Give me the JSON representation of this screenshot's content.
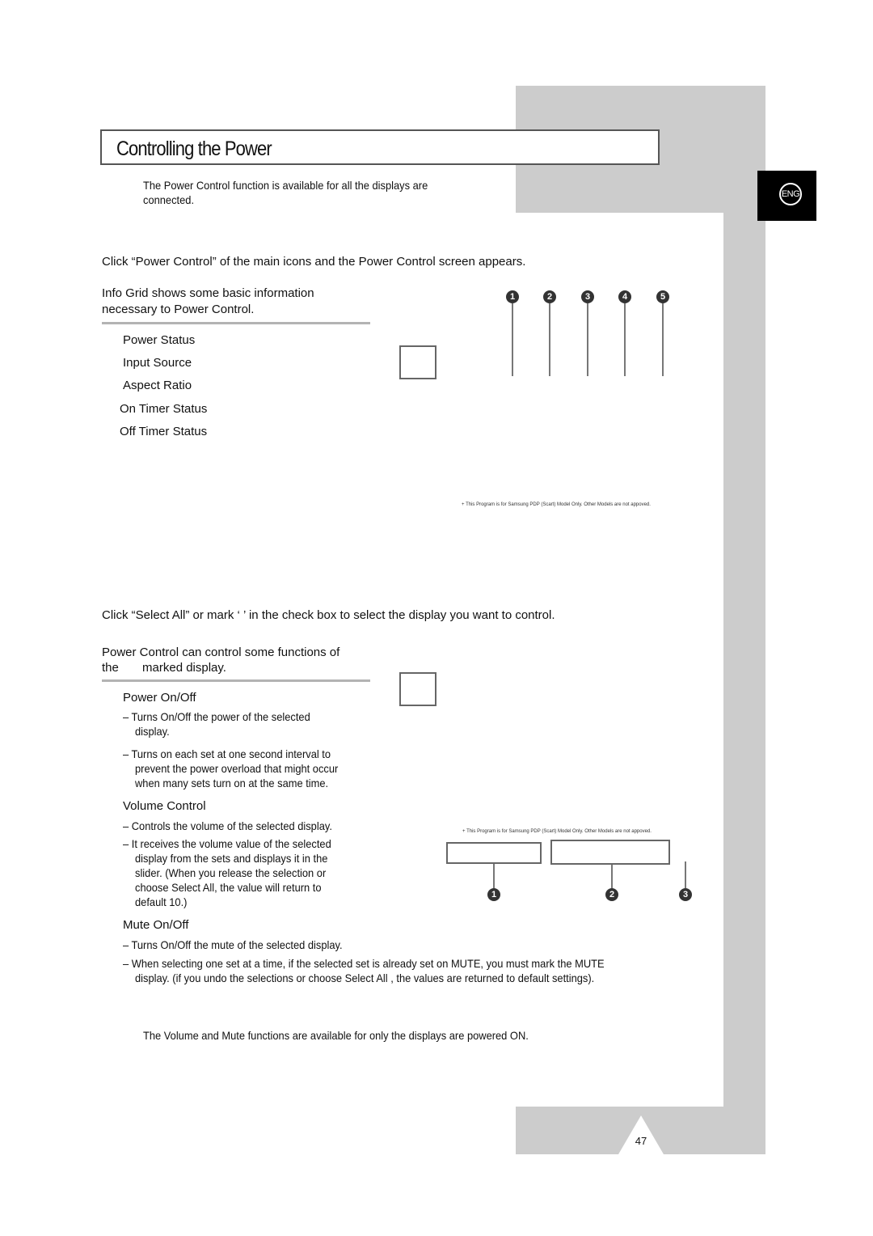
{
  "page": {
    "title": "Controlling the Power",
    "language_badge": "ENG",
    "page_number": "47"
  },
  "intro": {
    "note_line1": "The Power Control function is available for all the displays are",
    "note_line2": "connected."
  },
  "section1": {
    "instruction": "Click “Power Control” of the main icons and the Power Control screen appears.",
    "desc_line1": "Info Grid shows some basic information",
    "desc_line2": "necessary to Power Control.",
    "items": [
      "Power Status",
      "Input Source",
      "Aspect Ratio",
      "On Timer Status",
      "Off Timer Status"
    ],
    "callouts": [
      "1",
      "2",
      "3",
      "4",
      "5"
    ],
    "disclaimer": "+ This Program is for Samsung PDP (Scart) Model Only.  Other Models are not appoved."
  },
  "section2": {
    "instruction": "Click “Select All” or mark ‘    ’ in the check box to select the display you want to control.",
    "desc_line1": "Power Control can control some functions of",
    "desc_line2": "the       marked display.",
    "power": {
      "heading": "Power On/Off",
      "bullet1_line1": "– Turns On/Off the power of the selected",
      "bullet1_line2": "display.",
      "bullet2_line1": "– Turns on each set at one second interval to",
      "bullet2_line2": "prevent the power overload that might occur",
      "bullet2_line3": "when many sets turn on at the same time."
    },
    "volume": {
      "heading": "Volume Control",
      "bullet1": "– Controls the volume of the selected display.",
      "bullet2_line1": "– It receives the volume value of the selected",
      "bullet2_line2": "display from the sets and displays it in the",
      "bullet2_line3": "slider. (When you release the selection or",
      "bullet2_line4": "choose Select All, the value will return to",
      "bullet2_line5": "default 10.)"
    },
    "mute": {
      "heading": "Mute On/Off",
      "bullet1": "– Turns On/Off the mute of the selected display.",
      "bullet2_line1": "– When selecting one set at a time, if the selected set is already set on MUTE, you must mark the MUTE",
      "bullet2_line2": "display. (if you undo the selections or choose Select All , the values are returned to default settings)."
    },
    "callouts": [
      "1",
      "2",
      "3"
    ],
    "disclaimer": "+ This Program is for Samsung PDP (Scart) Model Only.  Other Models are not appoved."
  },
  "footer_note": "The Volume and Mute functions are available for only the displays are powered ON."
}
